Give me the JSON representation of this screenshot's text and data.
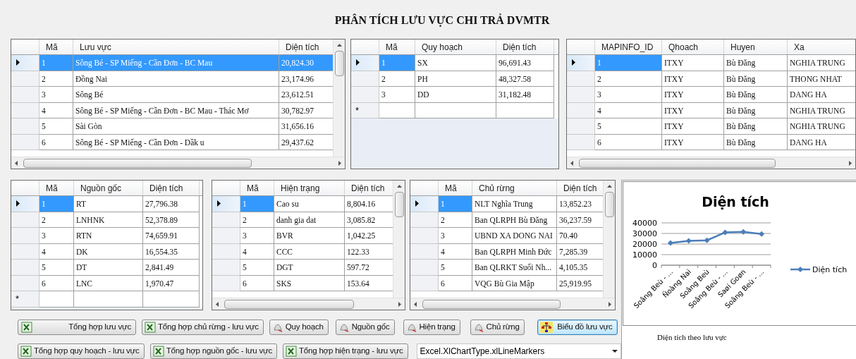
{
  "title": "PHÂN TÍCH LƯU VỰC CHI TRẢ DVMTR",
  "grids": [
    {
      "columns": [
        "Mã",
        "Lưu vực",
        "Diện tích"
      ],
      "rows": [
        {
          "cells": [
            "1",
            "Sông Bé - SP Miếng - Cần Đơn - BC Mau",
            "20,824.30"
          ],
          "selected": true
        },
        {
          "cells": [
            "2",
            "Đồng Nai",
            "23,174.96"
          ],
          "selected": false
        },
        {
          "cells": [
            "3",
            "Sông Bé",
            "23,612.51"
          ],
          "selected": false
        },
        {
          "cells": [
            "4",
            "Sông Bé - SP Miếng - Cần Đơn - BC Mau - Thác Mơ",
            "30,782.97"
          ],
          "selected": false
        },
        {
          "cells": [
            "5",
            "Sài Gòn",
            "31,656.16"
          ],
          "selected": false
        },
        {
          "cells": [
            "6",
            "Sông Bé - SP Miếng - Cần Đơn - Dầk u",
            "29,437.62"
          ],
          "selected": false
        }
      ]
    },
    {
      "new_row_marker": "*",
      "columns": [
        "Mã",
        "Quy hoạch",
        "Diện tích"
      ],
      "rows": [
        {
          "cells": [
            "1",
            "SX",
            "96,691.43"
          ],
          "selected": true
        },
        {
          "cells": [
            "2",
            "PH",
            "48,327.58"
          ],
          "selected": false
        },
        {
          "cells": [
            "3",
            "DD",
            "31,182.48"
          ],
          "selected": false
        }
      ]
    },
    {
      "columns": [
        "MAPINFO_ID",
        "Qhoach",
        "Huyen",
        "Xa"
      ],
      "rows": [
        {
          "cells": [
            "1",
            "ITXY",
            "Bù Đăng",
            "NGHIA TRUNG"
          ],
          "selected": true
        },
        {
          "cells": [
            "2",
            "ITXY",
            "Bù Đăng",
            "THONG NHAT"
          ],
          "selected": false
        },
        {
          "cells": [
            "3",
            "ITXY",
            "Bù Đăng",
            "DANG HA"
          ],
          "selected": false
        },
        {
          "cells": [
            "4",
            "ITXY",
            "Bù Đăng",
            "NGHIA TRUNG"
          ],
          "selected": false
        },
        {
          "cells": [
            "5",
            "ITXY",
            "Bù Đăng",
            "NGHIA TRUNG"
          ],
          "selected": false
        },
        {
          "cells": [
            "6",
            "ITXY",
            "Bù Đăng",
            "DANG HA"
          ],
          "selected": false
        }
      ]
    },
    {
      "new_row_marker": "*",
      "columns": [
        "Mã",
        "Nguồn gốc",
        "Diện tích"
      ],
      "rows": [
        {
          "cells": [
            "1",
            "RT",
            "27,796.38"
          ],
          "selected": true
        },
        {
          "cells": [
            "2",
            "LNHNK",
            "52,378.89"
          ],
          "selected": false
        },
        {
          "cells": [
            "3",
            "RTN",
            "74,659.91"
          ],
          "selected": false
        },
        {
          "cells": [
            "4",
            "DK",
            "16,554.35"
          ],
          "selected": false
        },
        {
          "cells": [
            "5",
            "DT",
            "2,841.49"
          ],
          "selected": false
        },
        {
          "cells": [
            "6",
            "LNC",
            "1,970.47"
          ],
          "selected": false
        }
      ]
    },
    {
      "columns": [
        "Mã",
        "Hiện trạng",
        "Diện tích"
      ],
      "rows": [
        {
          "cells": [
            "1",
            "Cao su",
            "8,804.16"
          ],
          "selected": true
        },
        {
          "cells": [
            "2",
            "danh gia dat",
            "3,085.82"
          ],
          "selected": false
        },
        {
          "cells": [
            "3",
            "BVR",
            "1,042.25"
          ],
          "selected": false
        },
        {
          "cells": [
            "4",
            "CCC",
            "122.33"
          ],
          "selected": false
        },
        {
          "cells": [
            "5",
            "DGT",
            "597.72"
          ],
          "selected": false
        },
        {
          "cells": [
            "6",
            "SKS",
            "153.64"
          ],
          "selected": false
        }
      ]
    },
    {
      "columns": [
        "Mã",
        "Chủ rừng",
        "Diện tích"
      ],
      "rows": [
        {
          "cells": [
            "1",
            "NLT Nghĩa Trung",
            "13,852.23"
          ],
          "selected": true
        },
        {
          "cells": [
            "2",
            "Ban QLRPH Bù Đăng",
            "36,237.59"
          ],
          "selected": false
        },
        {
          "cells": [
            "3",
            "UBND XA DONG NAI",
            "70.40"
          ],
          "selected": false
        },
        {
          "cells": [
            "4",
            "Ban QLRPH Minh Đức",
            "7,285.39"
          ],
          "selected": false
        },
        {
          "cells": [
            "5",
            "Ban QLRKT Suối Nh...",
            "4,105.35"
          ],
          "selected": false
        },
        {
          "cells": [
            "6",
            "VQG Bù Gia Mập",
            "25,919.95"
          ],
          "selected": false
        }
      ]
    }
  ],
  "buttons": [
    {
      "label": "Tổng hợp lưu vực",
      "focused": false
    },
    {
      "label": "Tổng hợp chủ rừng - lưu vực",
      "focused": false
    },
    {
      "label": "Quy hoạch",
      "focused": false
    },
    {
      "label": "Nguồn gốc",
      "focused": false
    },
    {
      "label": "Hiện trạng",
      "focused": false
    },
    {
      "label": "Chủ rừng",
      "focused": false
    },
    {
      "label": "Biểu đồ lưu vực",
      "focused": true
    },
    {
      "label": "Tổng hợp quy hoạch - lưu vực",
      "focused": false
    },
    {
      "label": "Tổng hợp nguồn gốc - lưu vực",
      "focused": false
    },
    {
      "label": "Tổng hợp hiện trạng - lưu vực",
      "focused": false
    }
  ],
  "chart_type_select": {
    "value": "Excel.XlChartType.xlLineMarkers"
  },
  "chart_panel": {
    "caption": "Diện tích theo lưu vực",
    "chart_data": {
      "type": "line",
      "title": "Diện tích",
      "categories": [
        "Soâng Beù - ...",
        "Ñoàng Nai",
        "Soâng Beù",
        "Soâng Beù - ...",
        "Saøi Goøn",
        "Soâng Beù - ..."
      ],
      "series": [
        {
          "name": "Diện tích",
          "color": "#4a7ebb",
          "marker": "diamond",
          "values": [
            21000,
            23000,
            23500,
            31000,
            31500,
            29500
          ]
        }
      ],
      "ylim": [
        0,
        40000
      ],
      "grid": true,
      "yticks": [
        0,
        10000,
        20000,
        30000,
        40000
      ]
    }
  }
}
